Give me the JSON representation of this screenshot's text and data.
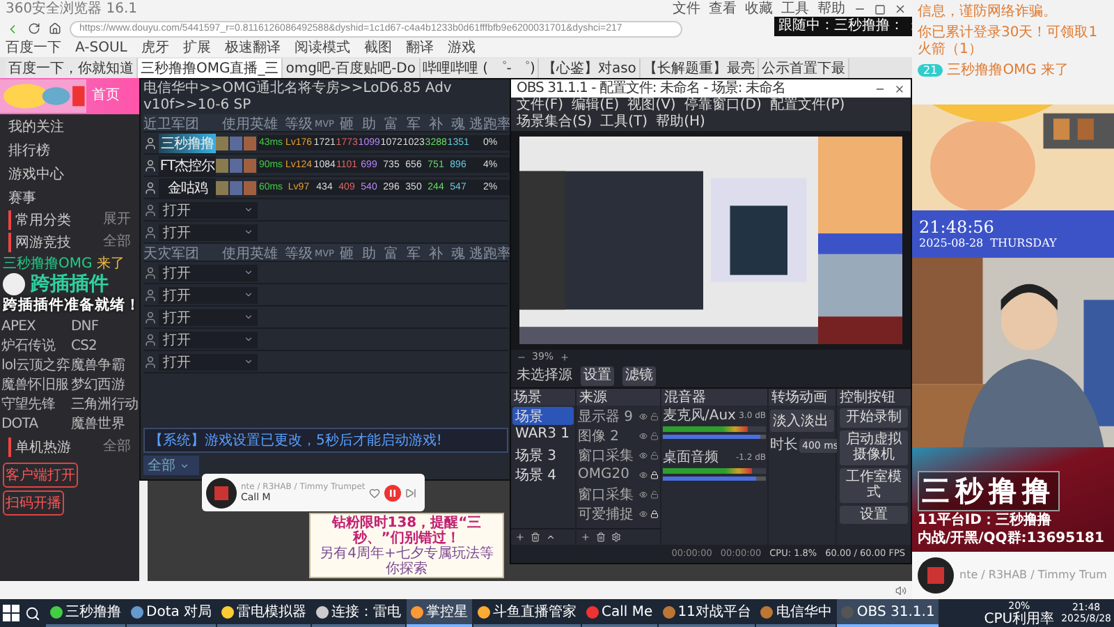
{
  "browser": {
    "title": "360安全浏览器 16.1",
    "menu": [
      "文件",
      "查看",
      "收藏",
      "工具",
      "帮助"
    ],
    "url": "https://www.douyu.com/5441597_r=0.8116126086492588&dyshid=1c1d67-c4a4b1233b0d61fffbfb9e6200031701&dyshci=217",
    "bookmarks": [
      "百度一下",
      "A-SOUL",
      "虎牙",
      "扩展",
      "极速翻译",
      "阅读模式",
      "截图",
      "翻译",
      "游戏"
    ],
    "tabs": [
      {
        "label": "百度一下，你就知道",
        "selected": false
      },
      {
        "label": "三秒撸撸OMG直播_三",
        "selected": true
      },
      {
        "label": "omg吧-百度贴吧-Do",
        "selected": false
      },
      {
        "label": "哔哩哔哩 ( ゜- ゜)",
        "selected": false
      },
      {
        "label": "【心鉴】对aso",
        "selected": false
      },
      {
        "label": "【长解题重】最亮",
        "selected": false
      },
      {
        "label": "公示首置下最",
        "selected": false
      }
    ],
    "notification": "跟随中：三秒撸撸："
  },
  "douyu": {
    "home": "首页",
    "nav": [
      "我的关注",
      "排行榜",
      "游戏中心",
      "赛事"
    ],
    "sections": [
      {
        "title": "常用分类",
        "action": "展开"
      },
      {
        "title": "网游竞技",
        "action": "全部"
      }
    ],
    "games": [
      "APEX",
      "DNF",
      "炉石传说",
      "CS2",
      "lol云顶之弈",
      "魔兽争霸",
      "魔兽怀旧服",
      "梦幻西游",
      "守望先锋",
      "三角洲行动",
      "DOTA",
      "魔兽世界"
    ],
    "section_after": {
      "title": "单机热游",
      "action": "全部"
    },
    "buttons": [
      "客户端打开",
      "扫码开播"
    ]
  },
  "plugin_overlay": {
    "user": "三秒撸撸OMG",
    "suffix": "来了",
    "title": "跨插插件",
    "message": "跨插插件准备就绪！"
  },
  "game_room": {
    "title": "电信华中>>OMG通北名将专房>>LoD6.85 Adv v10f>>10-6 SP",
    "teams": [
      {
        "name": "近卫军团",
        "heroes_label": "使用英雄",
        "columns": [
          "等级",
          "MVP",
          "砸",
          "助",
          "富",
          "军",
          "补",
          "魂",
          "逃跑率"
        ],
        "players": [
          {
            "name": "三秒撸撸",
            "highlight": true,
            "ping": "43ms",
            "level": "Lv176",
            "stats": [
              "1721",
              "1773",
              "1099",
              "1072",
              "1023",
              "3288",
              "1351",
              "0%"
            ]
          },
          {
            "name": "FT杰控尔",
            "highlight": false,
            "ping": "90ms",
            "level": "Lv124",
            "stats": [
              "1084",
              "1101",
              "699",
              "735",
              "656",
              "751",
              "896",
              "4%"
            ]
          },
          {
            "name": "金咕鸡",
            "highlight": false,
            "ping": "60ms",
            "level": "Lv97",
            "stats": [
              "434",
              "409",
              "540",
              "296",
              "350",
              "244",
              "547",
              "2%"
            ]
          }
        ],
        "open_slots": [
          "打开",
          "打开"
        ]
      },
      {
        "name": "天灾军团",
        "heroes_label": "使用英雄",
        "columns": [
          "等级",
          "MVP",
          "砸",
          "助",
          "富",
          "军",
          "补",
          "魂",
          "逃跑率"
        ],
        "open_slots": [
          "打开",
          "打开",
          "打开",
          "打开",
          "打开"
        ]
      }
    ],
    "system_message": "【系统】游戏设置已更改，5秒后才能启动游戏!",
    "chat_target": "全部"
  },
  "obs": {
    "title": "OBS 31.1.1 - 配置文件: 未命名 - 场景: 未命名",
    "menu": [
      "文件(F)",
      "编辑(E)",
      "视图(V)",
      "停靠窗口(D)",
      "配置文件(P)",
      "场景集合(S)",
      "工具(T)",
      "帮助(H)"
    ],
    "zoom": "39%",
    "source_bar": {
      "label": "未选择源",
      "buttons": [
        "设置",
        "滤镜"
      ]
    },
    "scenes": {
      "title": "场景",
      "items": [
        {
          "label": "场景",
          "selected": true
        },
        {
          "label": "WAR3 1",
          "selected": false
        },
        {
          "label": "场景 3",
          "selected": false
        },
        {
          "label": "场景 4",
          "selected": false
        }
      ]
    },
    "sources": {
      "title": "来源",
      "items": [
        {
          "label": "显示器 9",
          "locked": false
        },
        {
          "label": "图像 2",
          "locked": false
        },
        {
          "label": "窗口采集",
          "locked": false
        },
        {
          "label": "OMG20",
          "locked": true
        },
        {
          "label": "窗口采集",
          "locked": false
        },
        {
          "label": "可爱捕捉",
          "locked": true
        }
      ]
    },
    "mixer": {
      "title": "混音器",
      "channels": [
        {
          "name": "麦克风/Aux",
          "reading": "3.0 dB",
          "level": 0.82,
          "volume": {
            "level": 0.95
          }
        },
        {
          "name": "桌面音频",
          "reading": "-1.2 dB",
          "level": 0.86,
          "volume": {
            "level": 0.9
          }
        }
      ]
    },
    "transitions": {
      "title": "转场动画",
      "type": "淡入淡出",
      "duration_label": "时长",
      "duration": "400 ms"
    },
    "controls": {
      "title": "控制按钮",
      "buttons": [
        "开始录制",
        "启动虚拟摄像机",
        "工作室模式",
        "设置"
      ]
    },
    "status": {
      "stream_time": "00:00:00",
      "record_time": "00:00:00",
      "cpu": "CPU: 1.8%",
      "fps": "60.00 / 60.00 FPS"
    }
  },
  "music_player": {
    "artist": "nte / R3HAB / Timmy Trumpet",
    "title": "Call M"
  },
  "promo": {
    "headline": "钻粉限时138，提醒“三秒、”们别错过！",
    "subline": "另有4周年+七夕专属玩法等你探索"
  },
  "stream": {
    "chat": [
      {
        "text": "信息，谨防网络诈骗。"
      },
      {
        "text": "你已累计登录30天！可领取1火箭（1）"
      },
      {
        "text": "三秒撸撸OMG 来了",
        "badge": "21"
      }
    ],
    "time": "21:48:56",
    "date": "2025-08-28",
    "weekday": "THURSDAY",
    "streamer": "三秒撸撸",
    "platform_id": "11平台ID：三秒撸撸",
    "group": "内战/开黑/QQ群:13695181",
    "now_playing": "nte / R3HAB / Timmy Trum"
  },
  "taskbar": {
    "apps": [
      {
        "label": "三秒撸撸",
        "selected": false
      },
      {
        "label": "Dota 对局",
        "selected": false
      },
      {
        "label": "雷电模拟器",
        "selected": false
      },
      {
        "label": "连接：雷电",
        "selected": false
      },
      {
        "label": "掌控星",
        "selected": true
      },
      {
        "label": "斗鱼直播管家",
        "selected": false
      },
      {
        "label": "Call Me",
        "selected": false
      },
      {
        "label": "11对战平台",
        "selected": false
      },
      {
        "label": "电信华中",
        "selected": false
      },
      {
        "label": "OBS 31.1.1",
        "selected": true
      }
    ],
    "cpu": "20%",
    "cpu_label": "CPU利用率",
    "time": "21:48",
    "date": "2025/8/28"
  }
}
